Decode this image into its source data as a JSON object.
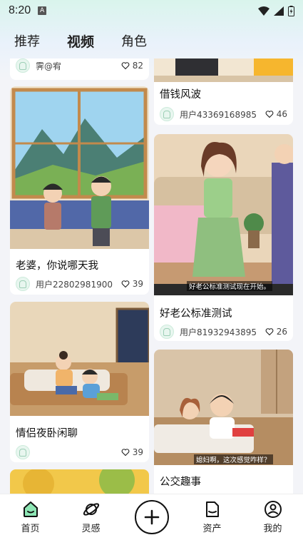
{
  "status": {
    "time": "8:20",
    "a_badge": "A"
  },
  "tabs": [
    {
      "label": "推荐"
    },
    {
      "label": "视频"
    },
    {
      "label": "角色"
    }
  ],
  "cards": [
    {
      "title": "",
      "user": "霁@宥",
      "likes": "82"
    },
    {
      "title": "借钱风波",
      "user": "用户43369168985",
      "likes": "46"
    },
    {
      "title": "老婆，你说哪天我",
      "user": "用户22802981900",
      "likes": "39"
    },
    {
      "title": "好老公标准测试",
      "user": "用户81932943895",
      "likes": "26",
      "caption": "好老公标准测试现在开始。"
    },
    {
      "title": "情侣夜卧闲聊",
      "user": "",
      "likes": "39"
    },
    {
      "title": "公交趣事",
      "user": "",
      "likes": "",
      "caption": "媳妇啊，这次感觉咋样？"
    }
  ],
  "nav": [
    {
      "label": "首页",
      "icon": "home-icon"
    },
    {
      "label": "灵感",
      "icon": "planet-icon"
    },
    {
      "label": "",
      "icon": "plus-icon"
    },
    {
      "label": "资产",
      "icon": "file-icon"
    },
    {
      "label": "我的",
      "icon": "profile-icon"
    }
  ],
  "colors": {
    "accent": "#8ee6b5",
    "heart": "#222222"
  }
}
